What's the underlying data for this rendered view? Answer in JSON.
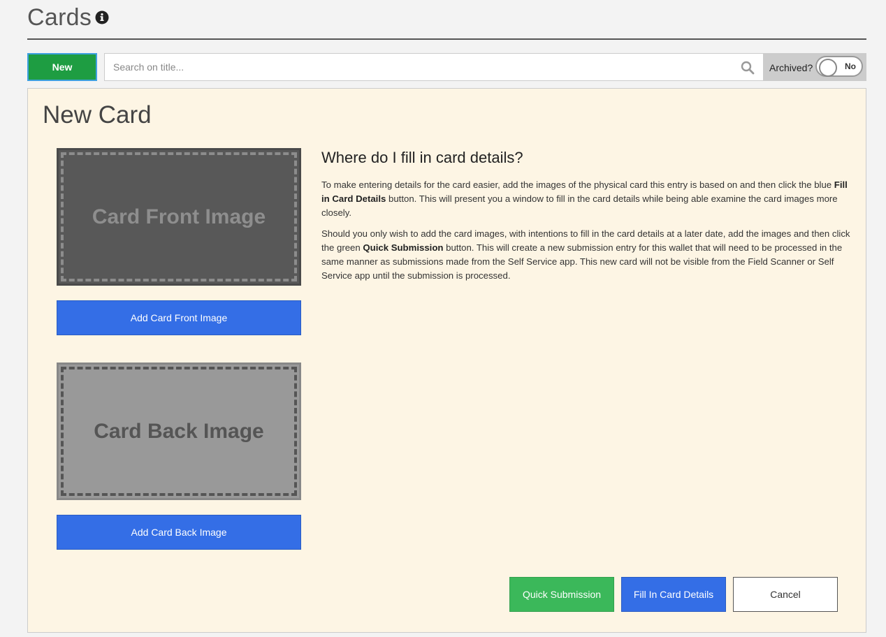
{
  "header": {
    "title": "Cards",
    "info_icon": "info-circle-icon"
  },
  "toolbar": {
    "new_label": "New",
    "search_placeholder": "Search on title...",
    "search_value": "",
    "search_icon": "search-icon",
    "archived_label": "Archived?",
    "archived_toggle_text": "No",
    "archived_on": false
  },
  "panel": {
    "title": "New Card",
    "front_image_placeholder": "Card Front Image",
    "add_front_label": "Add Card Front Image",
    "back_image_placeholder": "Card Back Image",
    "add_back_label": "Add Card Back Image"
  },
  "help": {
    "title": "Where do I fill in card details?",
    "p1_a": "To make entering details for the card easier, add the images of the physical card this entry is based on and then click the blue ",
    "p1_bold": "Fill in Card Details",
    "p1_b": " button. This will present you a window to fill in the card details while being able examine the card images more closely.",
    "p2_a": "Should you only wish to add the card images, with intentions to fill in the card details at a later date, add the images and then click the green ",
    "p2_bold": "Quick Submission",
    "p2_b": " button. This will create a new submission entry for this wallet that will need to be processed in the same manner as submissions made from the Self Service app. This new card will not be visible from the Field Scanner or Self Service app until the submission is processed."
  },
  "actions": {
    "quick_label": "Quick Submission",
    "fill_label": "Fill In Card Details",
    "cancel_label": "Cancel"
  },
  "colors": {
    "new_button": "#1e9d42",
    "primary_blue": "#346ee6",
    "quick_green": "#3bb85a",
    "panel_bg": "#fdf5e4"
  }
}
